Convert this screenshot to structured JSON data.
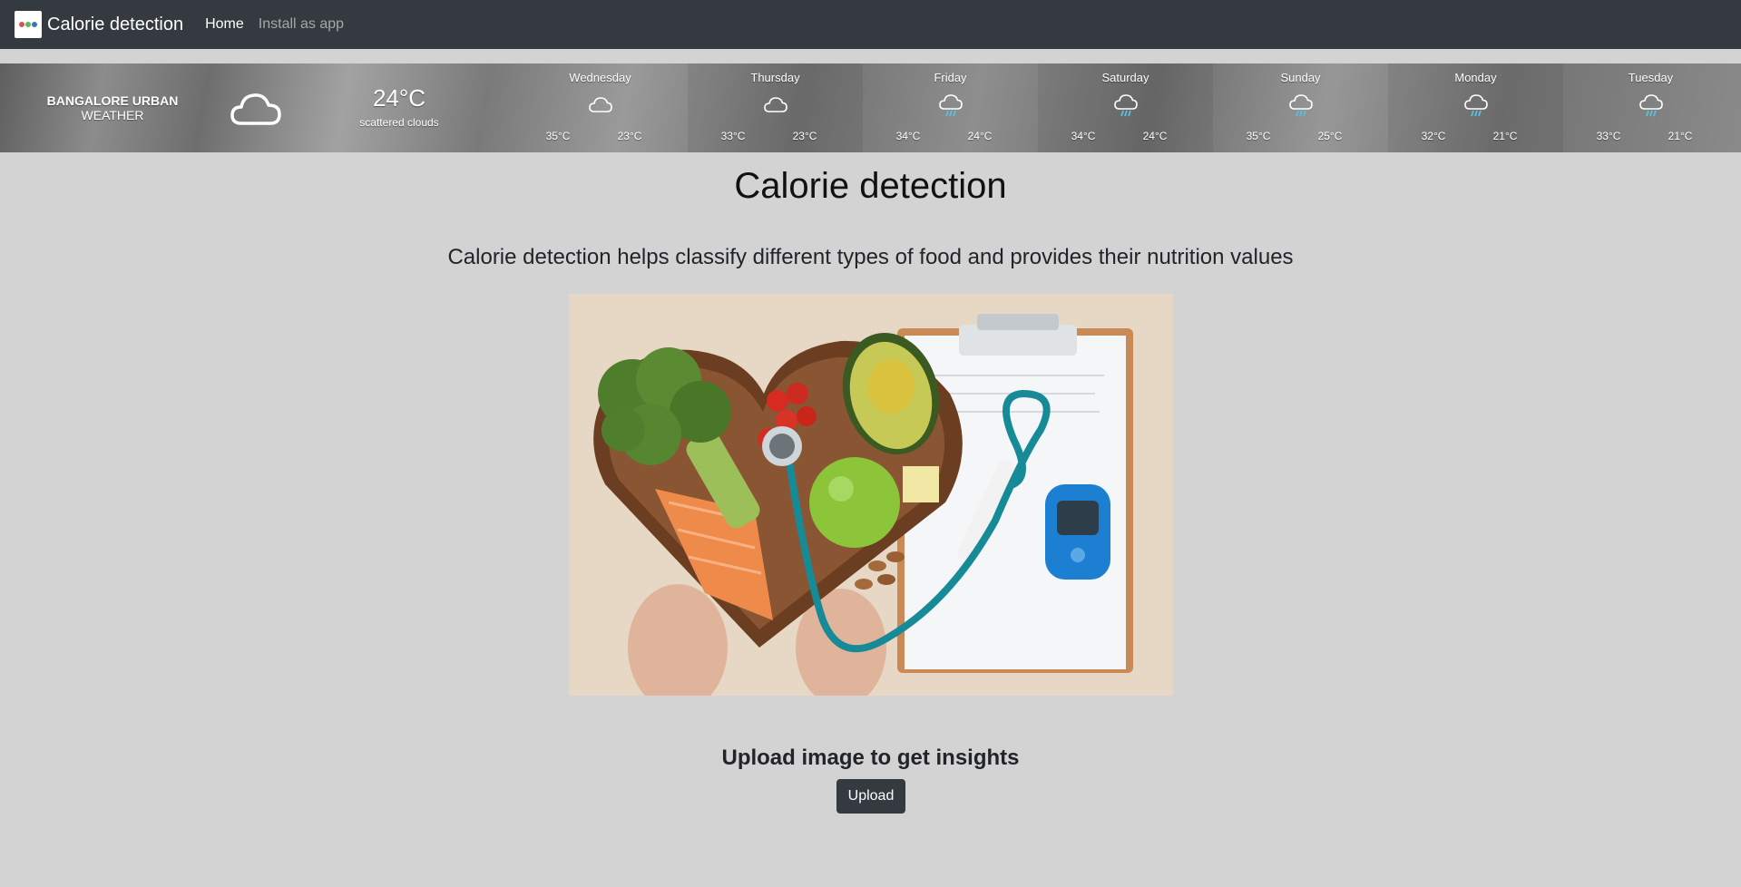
{
  "navbar": {
    "brand_title": "Calorie detection",
    "links": [
      {
        "label": "Home",
        "active": true
      },
      {
        "label": "Install as app",
        "active": false
      }
    ]
  },
  "weather": {
    "location_city": "BANGALORE URBAN",
    "location_sub": "WEATHER",
    "current": {
      "icon": "cloud-icon",
      "temp": "24°C",
      "description": "scattered clouds"
    },
    "days": [
      {
        "name": "Wednesday",
        "icon": "cloud-icon",
        "hi": "35°C",
        "lo": "23°C"
      },
      {
        "name": "Thursday",
        "icon": "cloud-icon",
        "hi": "33°C",
        "lo": "23°C"
      },
      {
        "name": "Friday",
        "icon": "rain-cloud-icon",
        "hi": "34°C",
        "lo": "24°C"
      },
      {
        "name": "Saturday",
        "icon": "rain-cloud-icon",
        "hi": "34°C",
        "lo": "24°C"
      },
      {
        "name": "Sunday",
        "icon": "rain-cloud-icon",
        "hi": "35°C",
        "lo": "25°C"
      },
      {
        "name": "Monday",
        "icon": "rain-cloud-icon",
        "hi": "32°C",
        "lo": "21°C"
      },
      {
        "name": "Tuesday",
        "icon": "rain-cloud-icon",
        "hi": "33°C",
        "lo": "21°C"
      }
    ]
  },
  "main": {
    "title": "Calorie detection",
    "lead": "Calorie detection helps classify different types of food and provides their nutrition values",
    "upload_title": "Upload image to get insights",
    "upload_label": "Upload"
  },
  "colors": {
    "navbar_bg": "#343a40",
    "page_bg": "#d3d3d3",
    "rain_drop": "#5bc0de"
  }
}
